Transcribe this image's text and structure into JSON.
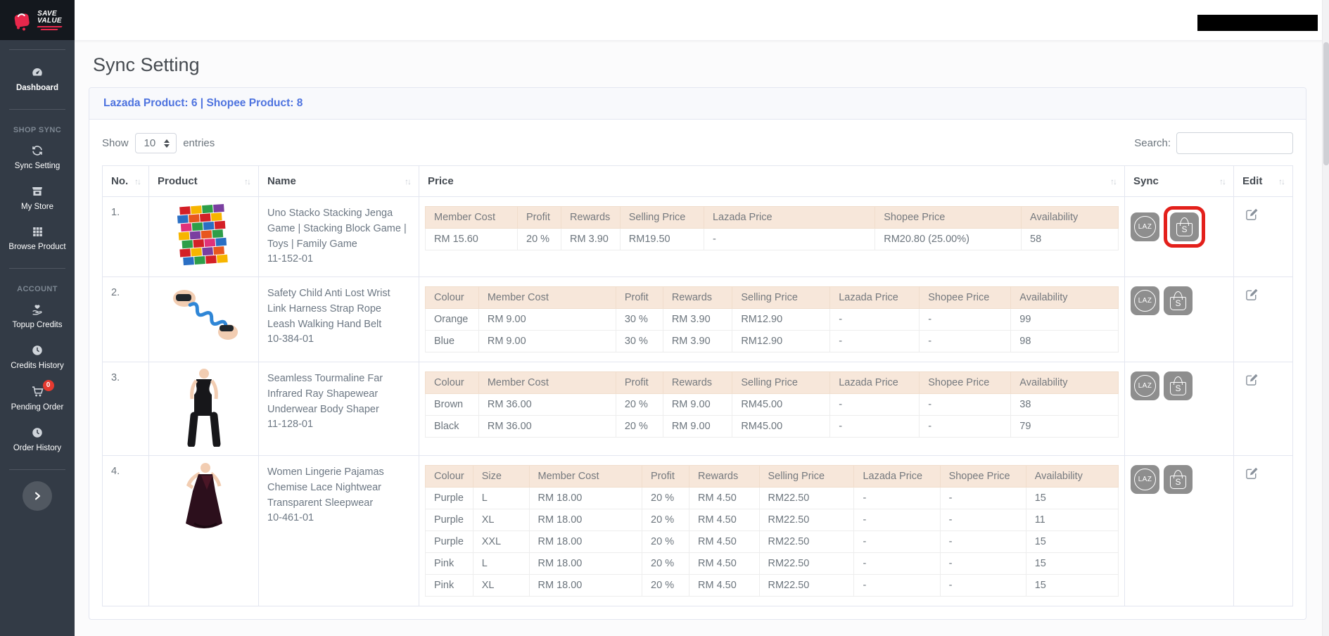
{
  "brand": {
    "line1": "SAVE",
    "line2": "VALUE"
  },
  "page": {
    "title": "Sync Setting"
  },
  "summary": {
    "text": "Lazada Product: 6 | Shopee Product: 8"
  },
  "sidebar": {
    "dashboard": "Dashboard",
    "shop_sync_section": "SHOP SYNC",
    "sync_setting": "Sync Setting",
    "my_store": "My Store",
    "browse_product": "Browse Product",
    "account_section": "ACCOUNT",
    "topup_credits": "Topup Credits",
    "credits_history": "Credits History",
    "pending_order": "Pending Order",
    "pending_badge": "0",
    "order_history": "Order History"
  },
  "controls": {
    "show_label": "Show",
    "page_size": "10",
    "entries_label": "entries",
    "search_label": "Search:",
    "search_value": ""
  },
  "sync": {
    "lazada_label": "LAZ",
    "shopee_label": "S"
  },
  "colors": {
    "accent_blue": "#4e73df",
    "highlight_red": "#e3201b",
    "subtable_header_bg": "#f7e7da",
    "sidebar_bg": "#333b46",
    "logo_bg": "#14181e",
    "brand_red": "#e8274b",
    "sync_button_gray": "#8e8e8e",
    "badge_red": "#e53a30"
  },
  "table": {
    "sort_icon": "↑↓",
    "headers": {
      "no": "No.",
      "product": "Product",
      "name": "Name",
      "price": "Price",
      "sync": "Sync",
      "edit": "Edit"
    },
    "rows": [
      {
        "no": "1.",
        "name": "Uno Stacko Stacking Jenga Game | Stacking Block Game | Toys | Family Game",
        "code": "11-152-01",
        "price": {
          "headers": [
            "Member Cost",
            "Profit",
            "Rewards",
            "Selling Price",
            "Lazada Price",
            "Shopee Price",
            "Availability"
          ],
          "rows": [
            [
              "RM 15.60",
              "20 %",
              "RM 3.90",
              "RM19.50",
              "-",
              "RM20.80 (25.00%)",
              "58"
            ]
          ]
        }
      },
      {
        "no": "2.",
        "name": "Safety Child Anti Lost Wrist Link Harness Strap Rope Leash Walking Hand Belt",
        "code": "10-384-01",
        "price": {
          "headers": [
            "Colour",
            "Member Cost",
            "Profit",
            "Rewards",
            "Selling Price",
            "Lazada Price",
            "Shopee Price",
            "Availability"
          ],
          "rows": [
            [
              "Orange",
              "RM 9.00",
              "30 %",
              "RM 3.90",
              "RM12.90",
              "-",
              "-",
              "99"
            ],
            [
              "Blue",
              "RM 9.00",
              "30 %",
              "RM 3.90",
              "RM12.90",
              "-",
              "-",
              "98"
            ]
          ]
        }
      },
      {
        "no": "3.",
        "name": "Seamless Tourmaline Far Infrared Ray Shapewear Underwear Body Shaper",
        "code": "11-128-01",
        "price": {
          "headers": [
            "Colour",
            "Member Cost",
            "Profit",
            "Rewards",
            "Selling Price",
            "Lazada Price",
            "Shopee Price",
            "Availability"
          ],
          "rows": [
            [
              "Brown",
              "RM 36.00",
              "20 %",
              "RM 9.00",
              "RM45.00",
              "-",
              "-",
              "38"
            ],
            [
              "Black",
              "RM 36.00",
              "20 %",
              "RM 9.00",
              "RM45.00",
              "-",
              "-",
              "79"
            ]
          ]
        }
      },
      {
        "no": "4.",
        "name": "Women Lingerie Pajamas Chemise Lace Nightwear Transparent Sleepwear",
        "code": "10-461-01",
        "price": {
          "headers": [
            "Colour",
            "Size",
            "Member Cost",
            "Profit",
            "Rewards",
            "Selling Price",
            "Lazada Price",
            "Shopee Price",
            "Availability"
          ],
          "rows": [
            [
              "Purple",
              "L",
              "RM 18.00",
              "20 %",
              "RM 4.50",
              "RM22.50",
              "-",
              "-",
              "15"
            ],
            [
              "Purple",
              "XL",
              "RM 18.00",
              "20 %",
              "RM 4.50",
              "RM22.50",
              "-",
              "-",
              "11"
            ],
            [
              "Purple",
              "XXL",
              "RM 18.00",
              "20 %",
              "RM 4.50",
              "RM22.50",
              "-",
              "-",
              "15"
            ],
            [
              "Pink",
              "L",
              "RM 18.00",
              "20 %",
              "RM 4.50",
              "RM22.50",
              "-",
              "-",
              "15"
            ],
            [
              "Pink",
              "XL",
              "RM 18.00",
              "20 %",
              "RM 4.50",
              "RM22.50",
              "-",
              "-",
              "15"
            ]
          ]
        }
      }
    ]
  }
}
